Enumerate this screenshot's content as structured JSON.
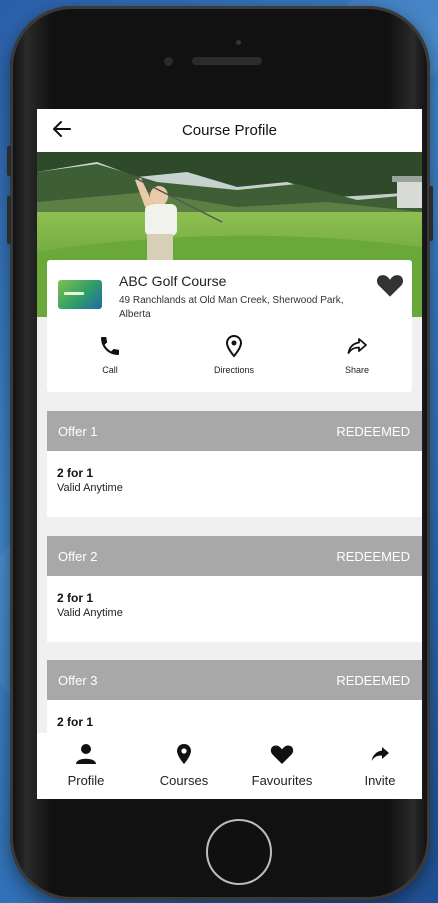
{
  "header": {
    "title": "Course Profile"
  },
  "course": {
    "name": "ABC Golf Course",
    "address": "49 Ranchlands at Old Man Creek, Sherwood Park, Alberta"
  },
  "actions": [
    {
      "label": "Call",
      "icon": "phone-icon"
    },
    {
      "label": "Directions",
      "icon": "map-pin-icon"
    },
    {
      "label": "Share",
      "icon": "share-icon"
    }
  ],
  "offers": [
    {
      "name": "Offer 1",
      "status": "REDEEMED",
      "deal": "2 for 1",
      "validity": "Valid Anytime"
    },
    {
      "name": "Offer 2",
      "status": "REDEEMED",
      "deal": "2 for 1",
      "validity": "Valid Anytime"
    },
    {
      "name": "Offer 3",
      "status": "REDEEMED",
      "deal": "2 for 1",
      "validity": ""
    }
  ],
  "tabs": [
    {
      "label": "Profile",
      "icon": "person-icon"
    },
    {
      "label": "Courses",
      "icon": "location-icon"
    },
    {
      "label": "Favourites",
      "icon": "heart-icon"
    },
    {
      "label": "Invite",
      "icon": "share-arrow-icon"
    }
  ],
  "colors": {
    "offer_header_bg": "#a8a8a8",
    "screen_bg": "#f0f0f0",
    "background_blue": "#3f86c9"
  }
}
